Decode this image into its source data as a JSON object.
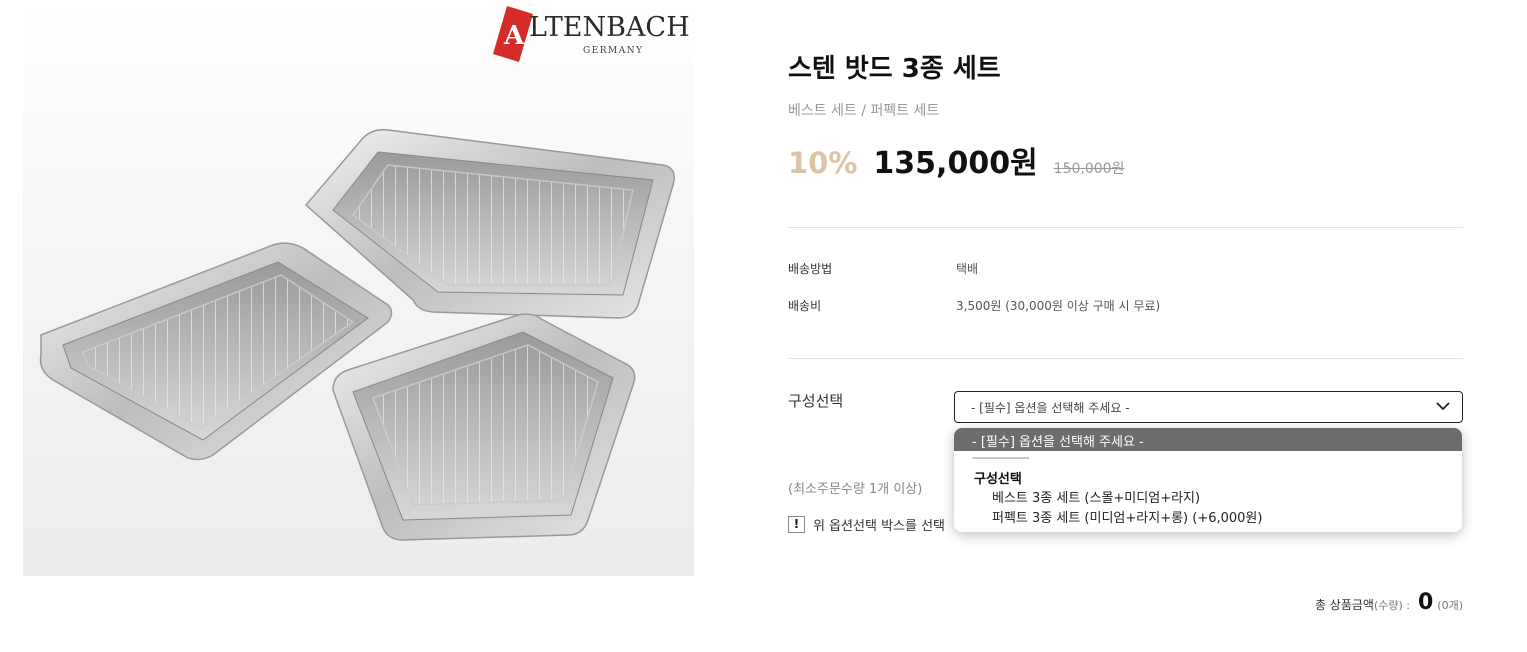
{
  "brand": {
    "logo_letter": "A",
    "logo_text": "LTENBACH",
    "logo_sub": "GERMANY",
    "logo_color": "#d62b2b"
  },
  "product": {
    "title": "스텐 밧드 3종 세트",
    "subtitle": "베스트 세트 / 퍼펙트 세트",
    "discount": "10%",
    "sale_price": "135,000원",
    "original_price": "150,000원"
  },
  "shipping": {
    "method_label": "배송방법",
    "method_value": "택배",
    "fee_label": "배송비",
    "fee_value": "3,500원 (30,000원 이상 구매 시 무료)"
  },
  "option": {
    "label": "구성선택",
    "selected": "- [필수] 옵션을 선택해 주세요 -",
    "dropdown": {
      "highlighted": "- [필수] 옵션을 선택해 주세요 -",
      "separator": "-------------------",
      "group": "구성선택",
      "items": [
        "베스트 3종 세트 (스몰+미디엄+라지)",
        "퍼펙트 3종 세트 (미디엄+라지+롱) (+6,000원)"
      ]
    }
  },
  "min_order": "(최소주문수량 1개 이상)",
  "notice": {
    "icon": "!",
    "text": "위 옵션선택 박스를 선택"
  },
  "total": {
    "label": "총 상품금액",
    "qty_label": "(수량) :",
    "amount": "0",
    "count": "(0개)"
  },
  "colors": {
    "discount": "#dcc4a6",
    "dropdown_highlight": "#6d6d6d"
  }
}
